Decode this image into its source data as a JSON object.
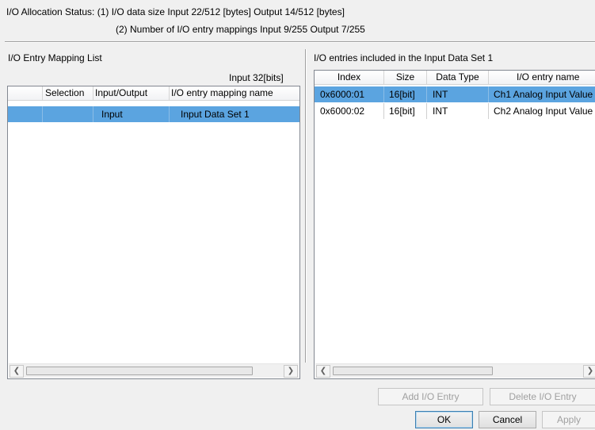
{
  "status": {
    "line1": "I/O Allocation Status: (1) I/O data size Input 22/512 [bytes] Output 14/512 [bytes]",
    "line2": "(2) Number of I/O entry mappings Input 9/255 Output 7/255"
  },
  "left_panel": {
    "title": "I/O Entry Mapping List",
    "input_bits": "Input 32[bits]",
    "columns": [
      "Selection",
      "Input/Output",
      "I/O entry mapping name"
    ],
    "rows": [
      {
        "selection": "",
        "io": "Input",
        "name": "Input Data Set 1",
        "selected": true
      }
    ]
  },
  "right_panel": {
    "title": "I/O entries included in the Input Data Set 1",
    "columns": [
      "Index",
      "Size",
      "Data Type",
      "I/O entry name"
    ],
    "rows": [
      {
        "index": "0x6000:01",
        "size": "16[bit]",
        "type": "INT",
        "name": "Ch1 Analog Input Value",
        "selected": true
      },
      {
        "index": "0x6000:02",
        "size": "16[bit]",
        "type": "INT",
        "name": "Ch2 Analog Input Value",
        "selected": false
      }
    ]
  },
  "buttons": {
    "add_entry": "Add I/O Entry",
    "delete_entry": "Delete I/O Entry",
    "ok": "OK",
    "cancel": "Cancel",
    "apply": "Apply"
  },
  "colors": {
    "selection": "#5ba4e0",
    "background": "#f0f0f0"
  }
}
